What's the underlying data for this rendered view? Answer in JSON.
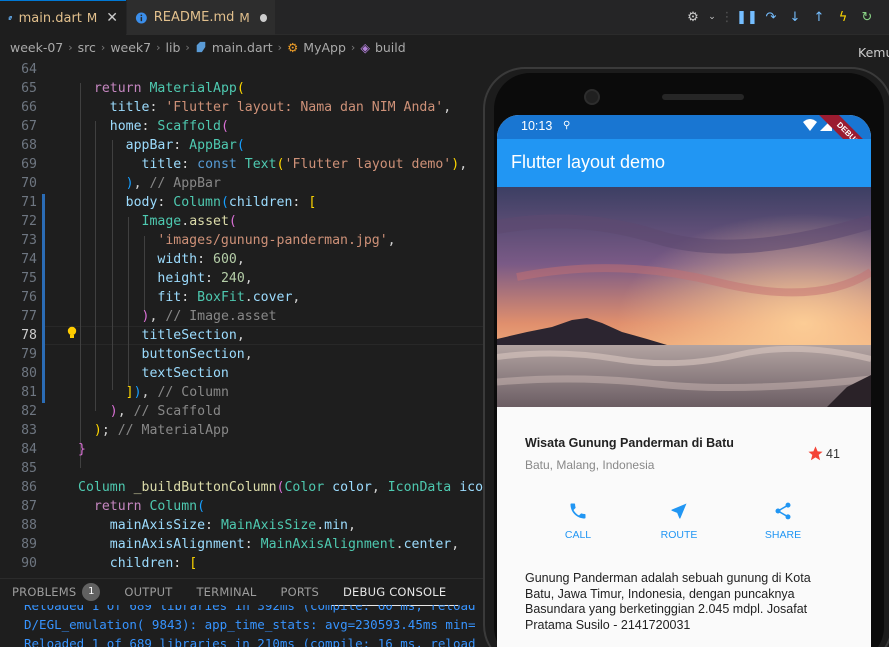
{
  "tabs": [
    {
      "label": "main.dart",
      "modified": "M",
      "icon": "dart-icon"
    },
    {
      "label": "README.md",
      "modified": "M",
      "icon": "info-icon"
    }
  ],
  "breadcrumb": [
    "week-07",
    "src",
    "week7",
    "lib",
    "main.dart",
    "MyApp",
    "build"
  ],
  "right_panel_label": "Kemu",
  "editor": {
    "current_line": 78,
    "lines": [
      {
        "n": 64,
        "html": ""
      },
      {
        "n": 65,
        "html": "  <span class='kw'>return</span> <span class='cls'>MaterialApp</span><span class='br1'>(</span>"
      },
      {
        "n": 66,
        "html": "    <span class='prop'>title</span>: <span class='str'>'Flutter layout: Nama dan NIM Anda'</span>,"
      },
      {
        "n": 67,
        "html": "    <span class='prop'>home</span>: <span class='cls'>Scaffold</span><span class='br2'>(</span>"
      },
      {
        "n": 68,
        "html": "      <span class='prop'>appBar</span>: <span class='cls'>AppBar</span><span class='br3'>(</span>"
      },
      {
        "n": 69,
        "html": "        <span class='prop'>title</span>: <span class='const'>const</span> <span class='cls'>Text</span><span class='br1'>(</span><span class='str'>'Flutter layout demo'</span><span class='br1'>)</span>,"
      },
      {
        "n": 70,
        "html": "      <span class='br3'>)</span>, <span class='cmt2'>// AppBar</span>"
      },
      {
        "n": 71,
        "html": "      <span class='prop'>body</span>: <span class='cls'>Column</span><span class='br3'>(</span><span class='prop'>children</span>: <span class='br1'>[</span>"
      },
      {
        "n": 72,
        "html": "        <span class='cls'>Image</span>.<span class='fn'>asset</span><span class='br2'>(</span>"
      },
      {
        "n": 73,
        "html": "          <span class='str'>'images/gunung-panderman.jpg'</span>,"
      },
      {
        "n": 74,
        "html": "          <span class='prop'>width</span>: <span class='num'>600</span>,"
      },
      {
        "n": 75,
        "html": "          <span class='prop'>height</span>: <span class='num'>240</span>,"
      },
      {
        "n": 76,
        "html": "          <span class='prop'>fit</span>: <span class='cls'>BoxFit</span>.<span class='prop'>cover</span>,"
      },
      {
        "n": 77,
        "html": "        <span class='br2'>)</span>, <span class='cmt2'>// Image.asset</span>"
      },
      {
        "n": 78,
        "html": "        <span class='prop'>titleSection</span>,"
      },
      {
        "n": 79,
        "html": "        <span class='prop'>buttonSection</span>,"
      },
      {
        "n": 80,
        "html": "        <span class='prop'>textSection</span>"
      },
      {
        "n": 81,
        "html": "      <span class='br1'>]</span><span class='br3'>)</span>, <span class='cmt2'>// Column</span>"
      },
      {
        "n": 82,
        "html": "    <span class='br2'>)</span>, <span class='cmt2'>// Scaffold</span>"
      },
      {
        "n": 83,
        "html": "  <span class='br1'>)</span>; <span class='cmt2'>// MaterialApp</span>"
      },
      {
        "n": 84,
        "html": "<span class='br2'>}</span>"
      },
      {
        "n": 85,
        "html": ""
      },
      {
        "n": 86,
        "html": "<span class='cls'>Column</span> <span class='fn'>_buildButtonColumn</span><span class='br2'>(</span><span class='cls'>Color</span> <span class='prop'>color</span>, <span class='cls'>IconData</span> <span class='prop'>icon</span>,"
      },
      {
        "n": 87,
        "html": "  <span class='kw'>return</span> <span class='cls'>Column</span><span class='br3'>(</span>"
      },
      {
        "n": 88,
        "html": "    <span class='prop'>mainAxisSize</span>: <span class='cls'>MainAxisSize</span>.<span class='prop'>min</span>,"
      },
      {
        "n": 89,
        "html": "    <span class='prop'>mainAxisAlignment</span>: <span class='cls'>MainAxisAlignment</span>.<span class='prop'>center</span>,"
      },
      {
        "n": 90,
        "html": "    <span class='prop'>children</span>: <span class='br1'>[</span>"
      }
    ]
  },
  "panel": {
    "tabs": [
      "PROBLEMS",
      "OUTPUT",
      "TERMINAL",
      "PORTS",
      "DEBUG CONSOLE"
    ],
    "problems_count": "1",
    "active": "DEBUG CONSOLE",
    "console_lines": [
      "Reloaded 1 of 689 libraries in 392ms (compile: 60 ms, reload",
      "D/EGL_emulation( 9843): app_time_stats: avg=230593.45ms min=",
      "Reloaded 1 of 689 libraries in 210ms (compile: 16 ms, reload"
    ]
  },
  "phone": {
    "status_time": "10:13",
    "debug_banner": "DEBUG",
    "appbar_title": "Flutter layout demo",
    "place_name": "Wisata Gunung Panderman di Batu",
    "place_location": "Batu, Malang, Indonesia",
    "star_count": "41",
    "buttons": [
      {
        "label": "CALL",
        "icon": "phone-icon"
      },
      {
        "label": "ROUTE",
        "icon": "navigation-icon"
      },
      {
        "label": "SHARE",
        "icon": "share-icon"
      }
    ],
    "description": "Gunung Panderman adalah sebuah gunung di Kota Batu, Jawa Timur, Indonesia, dengan puncaknya Basundara yang berketinggian 2.045 mdpl. Josafat Pratama Susilo - 2141720031",
    "accent_color": "#2196f3",
    "star_color": "#f44336"
  }
}
